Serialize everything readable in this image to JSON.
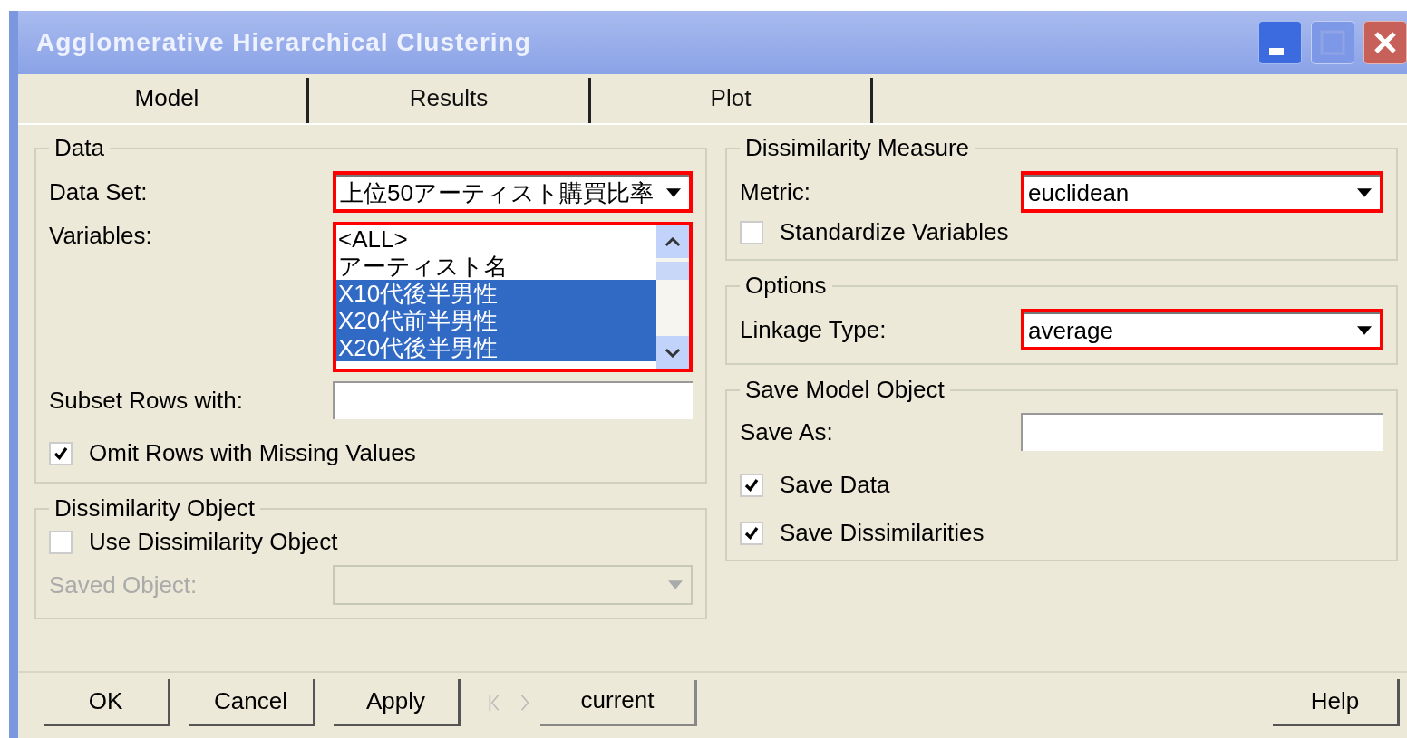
{
  "window": {
    "title": "Agglomerative Hierarchical Clustering"
  },
  "tabs": [
    {
      "label": "Model",
      "selected": true
    },
    {
      "label": "Results",
      "selected": false
    },
    {
      "label": "Plot",
      "selected": false
    }
  ],
  "data": {
    "title": "Data",
    "data_set": {
      "label": "Data Set:",
      "value": "上位50アーティスト購買比率",
      "highlighted": true
    },
    "variables": {
      "label": "Variables:",
      "highlighted": true,
      "items": [
        {
          "label": "<ALL>",
          "selected": false
        },
        {
          "label": "アーティスト名",
          "selected": false
        },
        {
          "label": "X10代後半男性",
          "selected": true
        },
        {
          "label": "X20代前半男性",
          "selected": true
        },
        {
          "label": "X20代後半男性",
          "selected": true
        }
      ]
    },
    "subset_rows": {
      "label": "Subset Rows with:"
    },
    "omit_missing": {
      "label": "Omit Rows with Missing Values",
      "checked": true
    }
  },
  "dissimilarity_object": {
    "title": "Dissimilarity Object",
    "use": {
      "label": "Use Dissimilarity Object",
      "checked": false
    },
    "saved_object": {
      "label": "Saved Object:",
      "disabled": true
    }
  },
  "dissimilarity_measure": {
    "title": "Dissimilarity Measure",
    "metric": {
      "label": "Metric:",
      "value": "euclidean",
      "highlighted": true
    },
    "standardize": {
      "label": "Standardize Variables",
      "checked": false
    }
  },
  "options": {
    "title": "Options",
    "linkage": {
      "label": "Linkage Type:",
      "value": "average",
      "highlighted": true
    }
  },
  "save_model": {
    "title": "Save Model Object",
    "save_as": {
      "label": "Save As:"
    },
    "save_data": {
      "label": "Save Data",
      "checked": true
    },
    "save_dissimilarities": {
      "label": "Save Dissimilarities",
      "checked": true
    }
  },
  "buttons": [
    "OK",
    "Cancel",
    "Apply"
  ],
  "navigator": {
    "value": "current"
  },
  "help_button": "Help"
}
